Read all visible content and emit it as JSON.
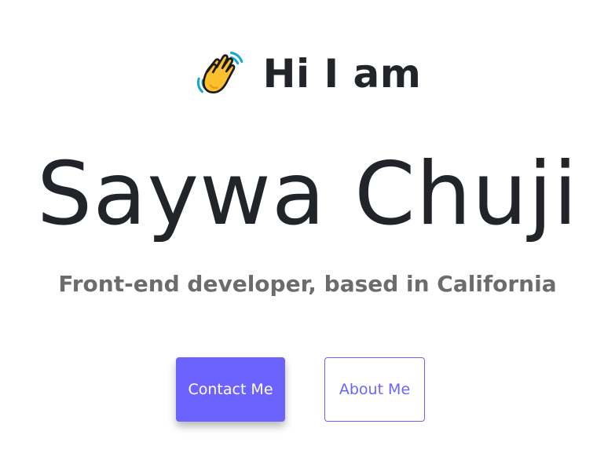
{
  "hero": {
    "greeting": "Hi I am",
    "greeting_icon": "waving-hand-icon",
    "name": "Saywa Chuji",
    "tagline": "Front-end developer, based in California"
  },
  "actions": {
    "contact_label": "Contact Me",
    "about_label": "About Me"
  },
  "colors": {
    "accent": "#6c63ff",
    "text_dark": "#212529",
    "text_muted": "#6c6c6c"
  }
}
